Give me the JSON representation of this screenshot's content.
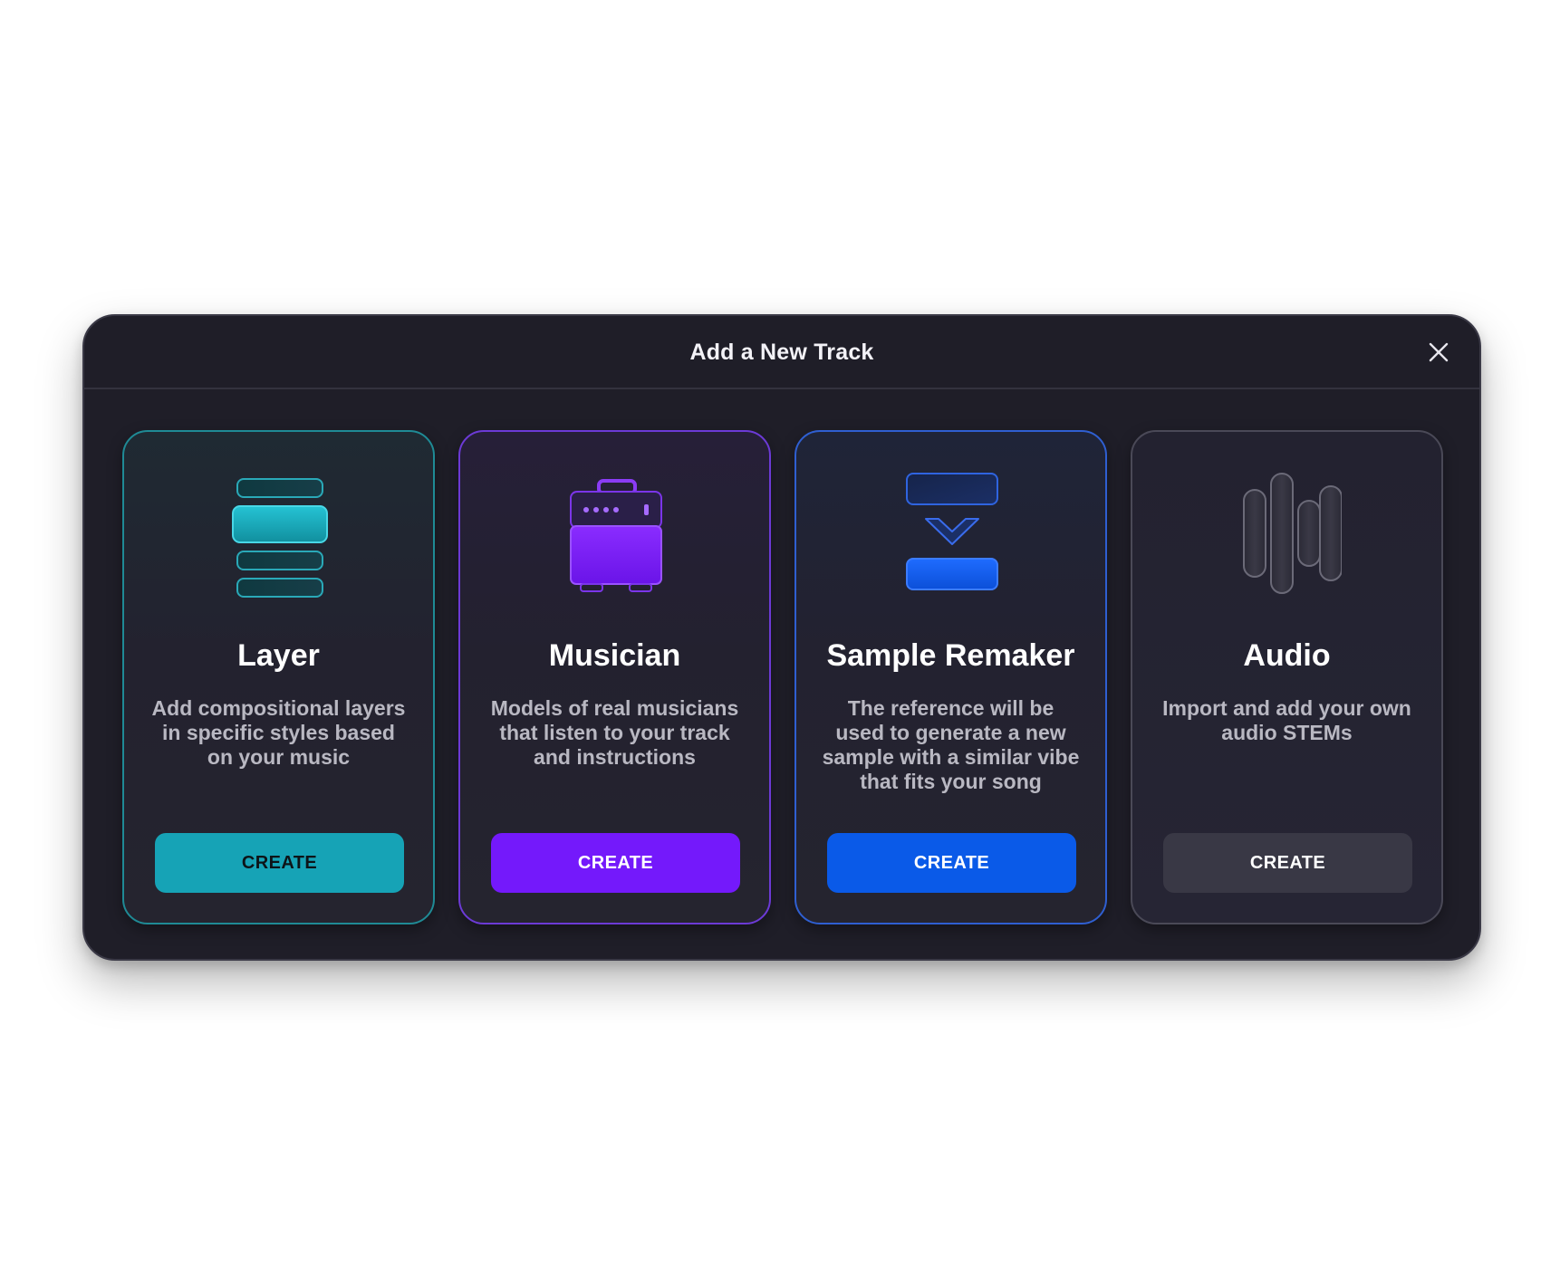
{
  "dialog": {
    "title": "Add a New Track",
    "close_icon": "close-icon"
  },
  "colors": {
    "dialog_bg": "#1f1e28",
    "layer_accent": "#16a3b6",
    "musician_accent": "#7419fb",
    "remaker_accent": "#0a5ae8",
    "audio_button": "#393845"
  },
  "cards": [
    {
      "id": "layer",
      "icon": "layers-stack-icon",
      "title": "Layer",
      "description": "Add compositional layers in specific styles based on your music",
      "button_label": "CREATE"
    },
    {
      "id": "musician",
      "icon": "amplifier-icon",
      "title": "Musician",
      "description": "Models of real musicians that listen to your track and instructions",
      "button_label": "CREATE"
    },
    {
      "id": "remaker",
      "icon": "sample-remake-icon",
      "title": "Sample Remaker",
      "description": "The reference will be used to generate a new sample with a similar vibe that fits your song",
      "button_label": "CREATE"
    },
    {
      "id": "audio",
      "icon": "audio-stems-icon",
      "title": "Audio",
      "description": "Import and add your own audio STEMs",
      "button_label": "CREATE"
    }
  ]
}
